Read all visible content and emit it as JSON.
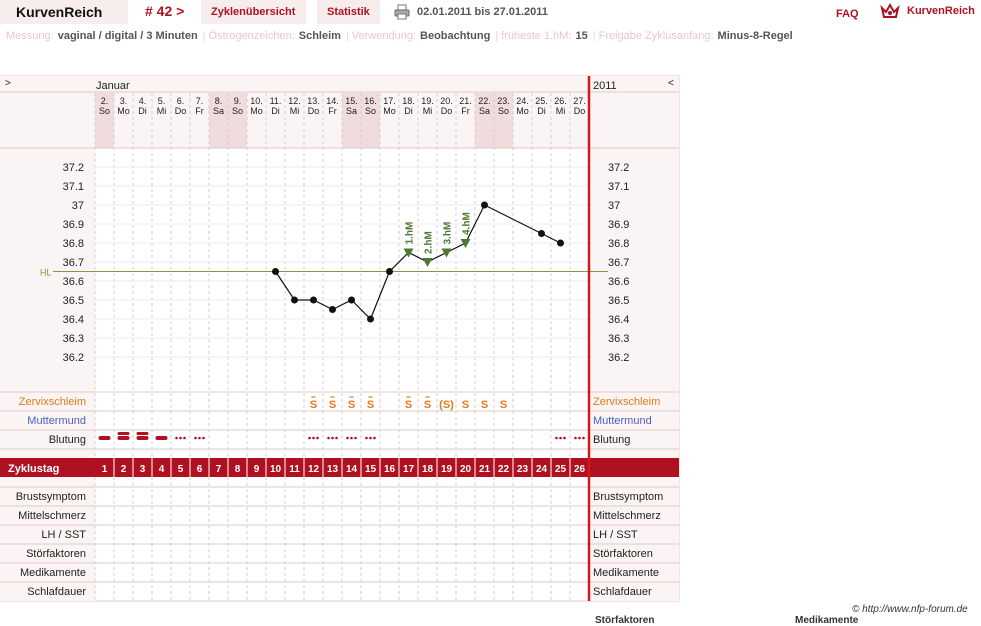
{
  "header": {
    "brand": "KurvenReich",
    "cycle_label": "# 42 >",
    "tab_overview": "Zyklenübersicht",
    "tab_stats": "Statistik",
    "date_range": "02.01.2011 bis 27.01.2011",
    "faq": "FAQ",
    "logo_text": "KurvenReich"
  },
  "info": [
    {
      "label": "Messung:",
      "value": "vaginal / digital / 3 Minuten"
    },
    {
      "label": "Östrogenzeichen:",
      "value": "Schleim"
    },
    {
      "label": "Verwendung:",
      "value": "Beobachtung"
    },
    {
      "label": "früheste 1.hM:",
      "value": "15"
    },
    {
      "label": "Freigabe Zyklusanfang:",
      "value": "Minus-8-Regel"
    }
  ],
  "chart_meta": {
    "nav_left": ">",
    "nav_right": "<",
    "month": "Januar",
    "year": "2011",
    "hl_label": "HL"
  },
  "days": [
    {
      "d": "2.",
      "w": "So",
      "we": true
    },
    {
      "d": "3.",
      "w": "Mo",
      "we": false
    },
    {
      "d": "4.",
      "w": "Di",
      "we": false
    },
    {
      "d": "5.",
      "w": "Mi",
      "we": false
    },
    {
      "d": "6.",
      "w": "Do",
      "we": false
    },
    {
      "d": "7.",
      "w": "Fr",
      "we": false
    },
    {
      "d": "8.",
      "w": "Sa",
      "we": true
    },
    {
      "d": "9.",
      "w": "So",
      "we": true
    },
    {
      "d": "10.",
      "w": "Mo",
      "we": false
    },
    {
      "d": "11.",
      "w": "Di",
      "we": false
    },
    {
      "d": "12.",
      "w": "Mi",
      "we": false
    },
    {
      "d": "13.",
      "w": "Do",
      "we": false
    },
    {
      "d": "14.",
      "w": "Fr",
      "we": false
    },
    {
      "d": "15.",
      "w": "Sa",
      "we": true
    },
    {
      "d": "16.",
      "w": "So",
      "we": true
    },
    {
      "d": "17.",
      "w": "Mo",
      "we": false
    },
    {
      "d": "18.",
      "w": "Di",
      "we": false
    },
    {
      "d": "19.",
      "w": "Mi",
      "we": false
    },
    {
      "d": "20.",
      "w": "Do",
      "we": false
    },
    {
      "d": "21.",
      "w": "Fr",
      "we": false
    },
    {
      "d": "22.",
      "w": "Sa",
      "we": true
    },
    {
      "d": "23.",
      "w": "So",
      "we": true
    },
    {
      "d": "24.",
      "w": "Mo",
      "we": false
    },
    {
      "d": "25.",
      "w": "Di",
      "we": false
    },
    {
      "d": "26.",
      "w": "Mi",
      "we": false
    },
    {
      "d": "27.",
      "w": "Do",
      "we": false
    }
  ],
  "chart_data": {
    "type": "line",
    "x": [
      10,
      11,
      12,
      13,
      14,
      15,
      16,
      17,
      18,
      19,
      20,
      21,
      24,
      25
    ],
    "values": [
      36.65,
      36.5,
      36.5,
      36.45,
      36.5,
      36.4,
      36.65,
      36.75,
      36.7,
      36.75,
      36.8,
      37.0,
      36.85,
      36.8
    ],
    "ylim": [
      36.1,
      37.3
    ],
    "yticks": [
      "37.2",
      "37.1",
      "37",
      "36.9",
      "36.8",
      "36.7",
      "36.6",
      "36.5",
      "36.4",
      "36.3",
      "36.2"
    ],
    "hl": 36.65,
    "high_marks": [
      {
        "day": 17,
        "label": "1.hM"
      },
      {
        "day": 18,
        "label": "2.hM"
      },
      {
        "day": 19,
        "label": "3.hM"
      },
      {
        "day": 20,
        "label": "4.hM"
      }
    ]
  },
  "mucus": [
    {
      "day": 12,
      "s": "S"
    },
    {
      "day": 13,
      "s": "S"
    },
    {
      "day": 14,
      "s": "S"
    },
    {
      "day": 15,
      "s": "S"
    },
    {
      "day": 17,
      "s": "S"
    },
    {
      "day": 18,
      "s": "S"
    },
    {
      "day": 19,
      "s": "(S)"
    },
    {
      "day": 20,
      "s": "S"
    },
    {
      "day": 21,
      "s": "S"
    },
    {
      "day": 22,
      "s": "S"
    }
  ],
  "bleeding": [
    {
      "day": 1,
      "t": "heavy"
    },
    {
      "day": 2,
      "t": "heavy"
    },
    {
      "day": 3,
      "t": "heavy"
    },
    {
      "day": 4,
      "t": "heavy"
    },
    {
      "day": 5,
      "t": "spot"
    },
    {
      "day": 6,
      "t": "spot"
    },
    {
      "day": 12,
      "t": "spot"
    },
    {
      "day": 13,
      "t": "spot"
    },
    {
      "day": 14,
      "t": "spot"
    },
    {
      "day": 15,
      "t": "spot"
    },
    {
      "day": 25,
      "t": "spot"
    },
    {
      "day": 26,
      "t": "spot"
    }
  ],
  "rows_upper": [
    "Zervixschleim",
    "Muttermund",
    "Blutung"
  ],
  "cycle_label": "Zyklustag",
  "rows_lower": [
    "Brustsymptom",
    "Mittelschmerz",
    "LH / SST",
    "Störfaktoren",
    "Medikamente",
    "Schlafdauer"
  ],
  "footer": {
    "copyright": "© http://www.nfp-forum.de",
    "cut_1": "Störfaktoren",
    "cut_2": "Medikamente"
  },
  "colors": {
    "brand_red": "#b01020",
    "pink_bg": "#f7eded",
    "weekend": "#f0dcdc",
    "mucus": "#e07b1a",
    "cervix": "#4a60c0",
    "hl_line": "#7a9a4a",
    "marker": "#4d7a33"
  }
}
